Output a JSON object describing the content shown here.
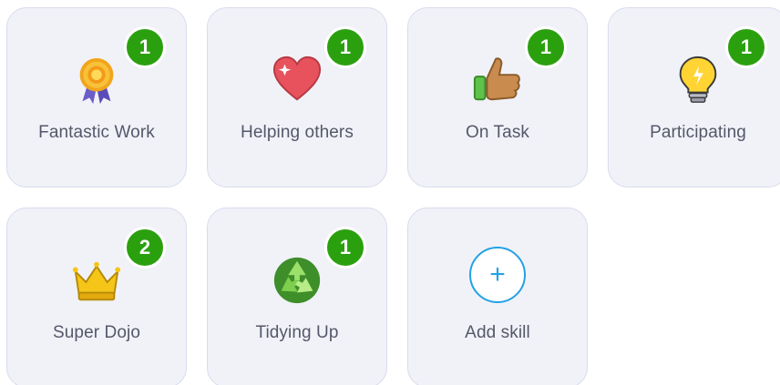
{
  "skills": [
    {
      "label": "Fantastic Work",
      "count": "1",
      "icon": "award-ribbon-icon"
    },
    {
      "label": "Helping others",
      "count": "1",
      "icon": "heart-icon"
    },
    {
      "label": "On Task",
      "count": "1",
      "icon": "thumbs-up-icon"
    },
    {
      "label": "Participating",
      "count": "1",
      "icon": "lightbulb-icon"
    },
    {
      "label": "Super Dojo",
      "count": "2",
      "icon": "crown-icon"
    },
    {
      "label": "Tidying Up",
      "count": "1",
      "icon": "recycle-icon"
    }
  ],
  "add_skill": {
    "label": "Add skill",
    "symbol": "+",
    "icon": "plus-circle-icon"
  },
  "colors": {
    "badge": "#2ba00f",
    "card_background": "#f1f2f8",
    "card_border": "#d9dbed",
    "add_accent": "#23a2e6",
    "label_text": "#55576a"
  }
}
